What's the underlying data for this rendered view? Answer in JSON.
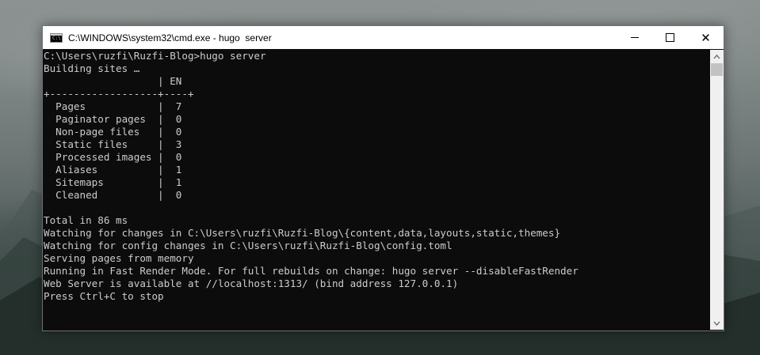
{
  "window": {
    "title": "C:\\WINDOWS\\system32\\cmd.exe - hugo  server",
    "icon": "cmd-app-icon",
    "icon_text": "C:\\"
  },
  "controls": {
    "minimize": "minimize-icon",
    "maximize": "maximize-icon",
    "close_label": "✕"
  },
  "console": {
    "lines": [
      "C:\\Users\\ruzfi\\Ruzfi-Blog>hugo server",
      "Building sites …",
      "                   | EN",
      "+------------------+----+",
      "  Pages            |  7",
      "  Paginator pages  |  0",
      "  Non-page files   |  0",
      "  Static files     |  3",
      "  Processed images |  0",
      "  Aliases          |  1",
      "  Sitemaps         |  1",
      "  Cleaned          |  0",
      "",
      "Total in 86 ms",
      "Watching for changes in C:\\Users\\ruzfi\\Ruzfi-Blog\\{content,data,layouts,static,themes}",
      "Watching for config changes in C:\\Users\\ruzfi\\Ruzfi-Blog\\config.toml",
      "Serving pages from memory",
      "Running in Fast Render Mode. For full rebuilds on change: hugo server --disableFastRender",
      "Web Server is available at //localhost:1313/ (bind address 127.0.0.1)",
      "Press Ctrl+C to stop"
    ]
  },
  "colors": {
    "console_bg": "#0c0c0c",
    "console_fg": "#cccccc",
    "titlebar_bg": "#ffffff"
  }
}
